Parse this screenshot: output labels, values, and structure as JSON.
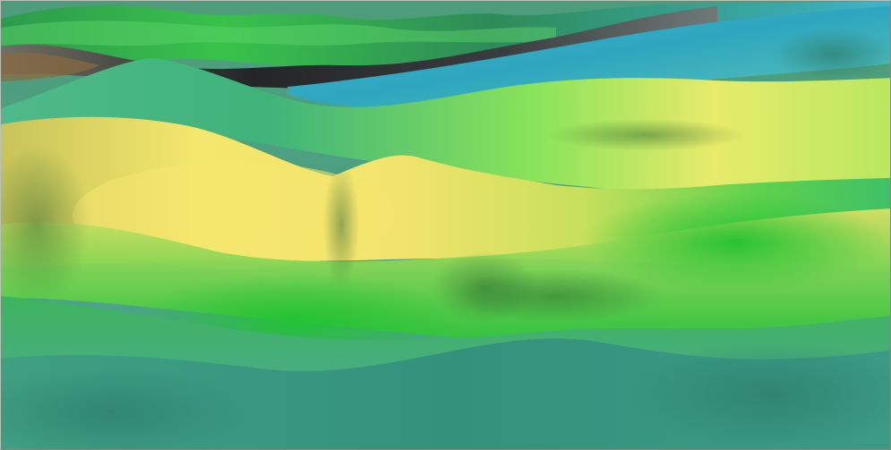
{
  "scene": {
    "palette": {
      "deep_teal": "#2f8f7d",
      "teal": "#4bb08d",
      "green": "#29c23a",
      "light_green": "#7ee35a",
      "yellow": "#f0e06a",
      "cyan": "#3fb3c9",
      "dark_gray": "#2d2f31",
      "brown": "#8a6a3f",
      "sky": "#79c6d6"
    }
  },
  "hud": {
    "lines": [
      "",
      "",
      ""
    ]
  }
}
